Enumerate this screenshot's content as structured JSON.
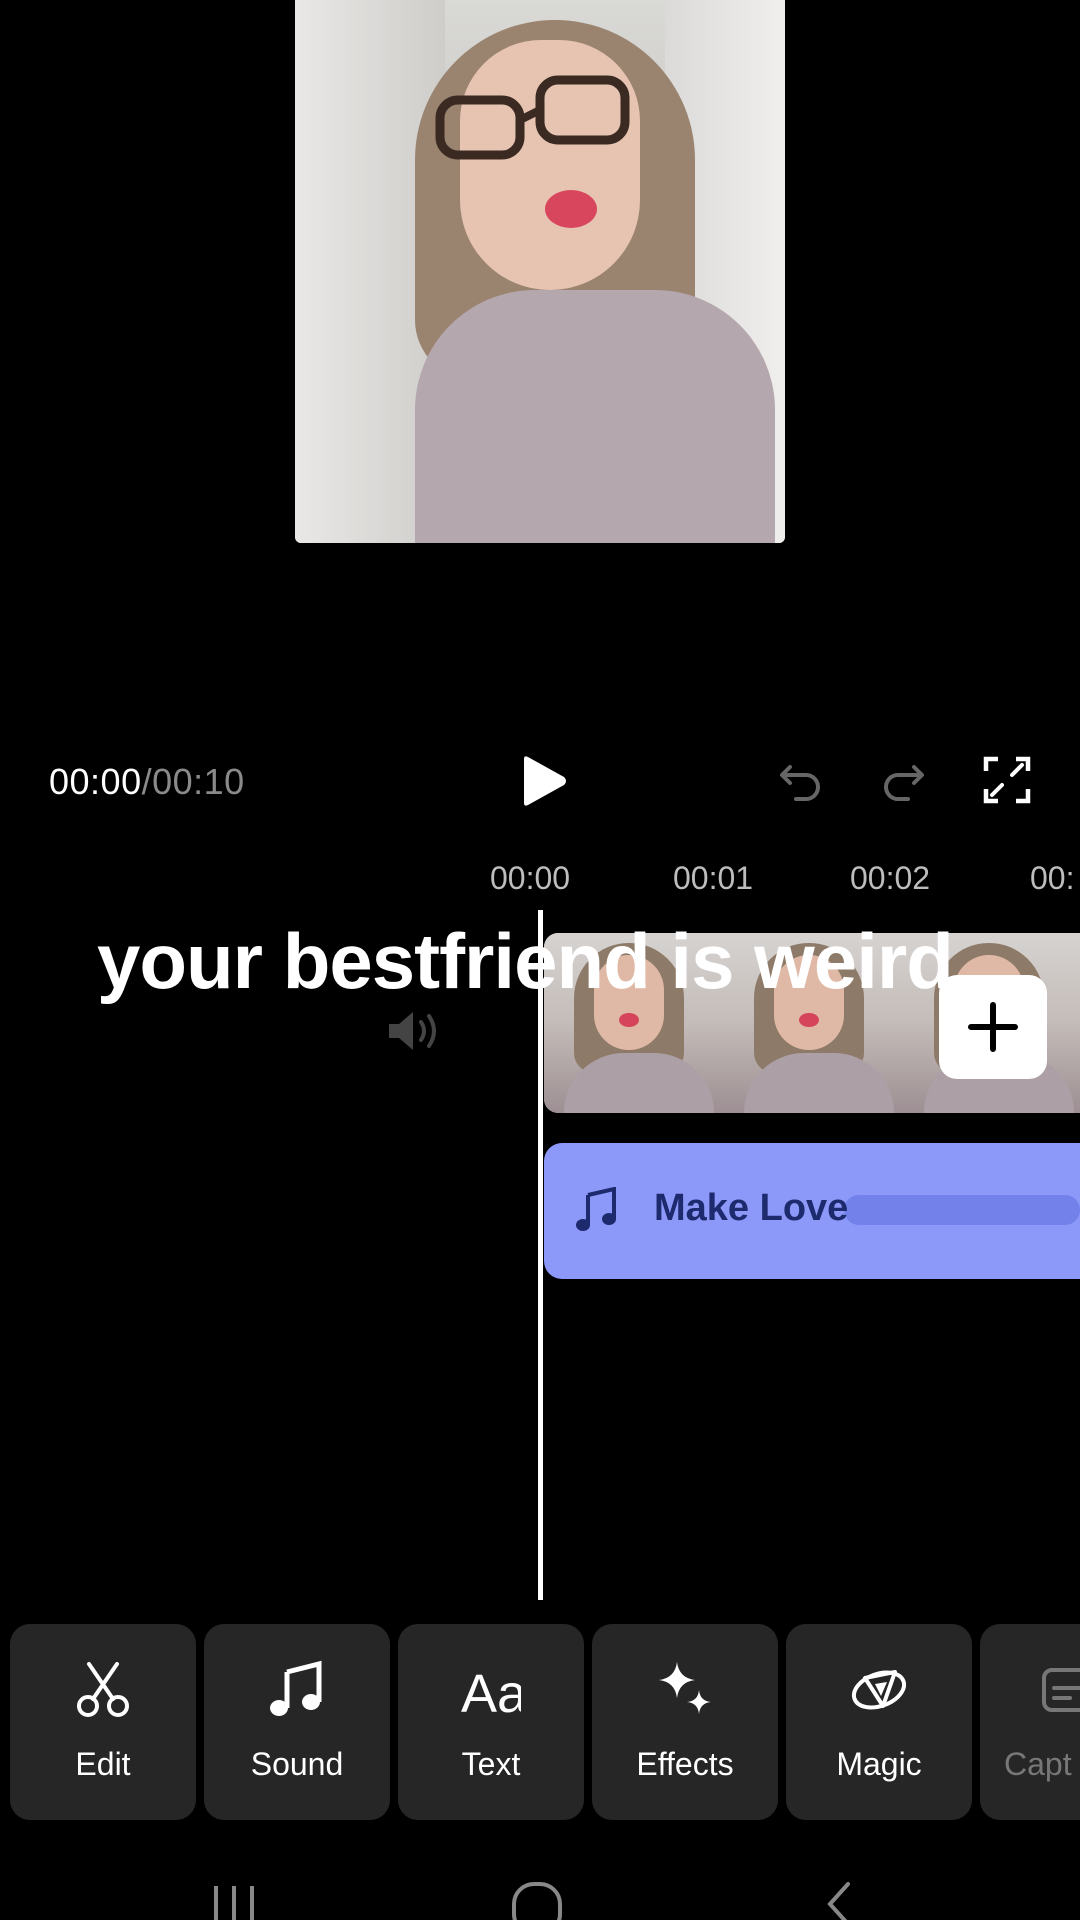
{
  "player": {
    "current_time": "00:00",
    "separator": "/",
    "total_time": "00:10"
  },
  "ruler": {
    "ticks": [
      "00:00",
      "00:01",
      "00:02",
      "00:"
    ]
  },
  "overlay": {
    "caption": "your bestfriend is weird"
  },
  "audio_track": {
    "title": "Make Love",
    "color": "#8d99f8"
  },
  "toolbar": {
    "items": [
      {
        "label": "Edit",
        "icon": "scissors-icon"
      },
      {
        "label": "Sound",
        "icon": "music-note-icon"
      },
      {
        "label": "Text",
        "icon": "text-aa-icon"
      },
      {
        "label": "Effects",
        "icon": "sparkles-icon"
      },
      {
        "label": "Magic",
        "icon": "magic-icon"
      },
      {
        "label": "Capt",
        "icon": "captions-icon"
      }
    ]
  }
}
